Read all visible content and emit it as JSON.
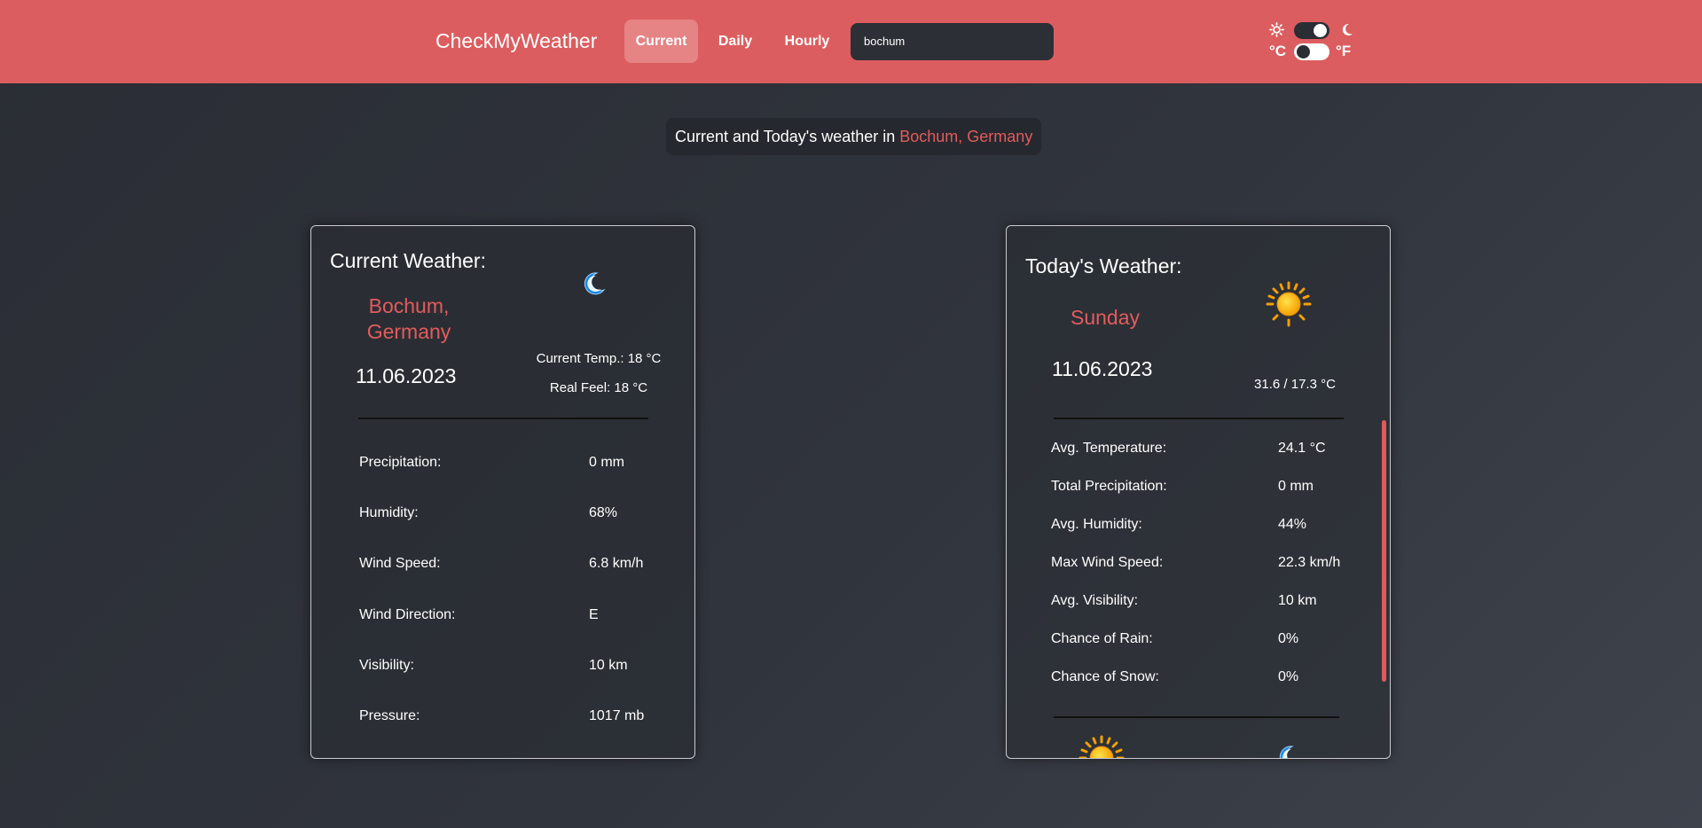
{
  "navbar": {
    "brand": "CheckMyWeather",
    "tabs": [
      {
        "label": "Current",
        "active": true
      },
      {
        "label": "Daily",
        "active": false
      },
      {
        "label": "Hourly",
        "active": false
      }
    ],
    "search_value": "bochum",
    "theme_toggle": {
      "left_icon": "sun-icon",
      "right_icon": "moon-icon",
      "state": "dark"
    },
    "unit_toggle": {
      "left_label": "°C",
      "right_label": "°F",
      "state": "celsius"
    }
  },
  "subtitle": {
    "prefix": "Current and Today's weather in",
    "location": "Bochum, Germany"
  },
  "current": {
    "title": "Current Weather:",
    "city_line1": "Bochum,",
    "city_line2": "Germany",
    "date": "11.06.2023",
    "icon": "moon-icon",
    "current_temp": "Current Temp.: 18 °C",
    "real_feel": "Real Feel: 18 °C",
    "rows": [
      {
        "label": "Precipitation:",
        "value": "0 mm"
      },
      {
        "label": "Humidity:",
        "value": "68%"
      },
      {
        "label": "Wind Speed:",
        "value": "6.8 km/h"
      },
      {
        "label": "Wind Direction:",
        "value": "E"
      },
      {
        "label": "Visibility:",
        "value": "10 km"
      },
      {
        "label": "Pressure:",
        "value": "1017 mb"
      }
    ]
  },
  "today": {
    "title": "Today's Weather:",
    "day": "Sunday",
    "date": "11.06.2023",
    "icon": "sun-icon",
    "temp_range": "31.6 / 17.3 °C",
    "rows": [
      {
        "label": "Avg. Temperature:",
        "value": "24.1 °C"
      },
      {
        "label": "Total Precipitation:",
        "value": "0 mm"
      },
      {
        "label": "Avg. Humidity:",
        "value": "44%"
      },
      {
        "label": "Max Wind Speed:",
        "value": "22.3 km/h"
      },
      {
        "label": "Avg. Visibility:",
        "value": "10 km"
      },
      {
        "label": "Chance of Rain:",
        "value": "0%"
      },
      {
        "label": "Chance of Snow:",
        "value": "0%"
      }
    ],
    "bottom_icons": [
      "sun-icon",
      "moon-icon"
    ]
  },
  "colors": {
    "navbar": "#dc5d5f",
    "accent": "#e35b5d",
    "background": "#2e3138"
  }
}
